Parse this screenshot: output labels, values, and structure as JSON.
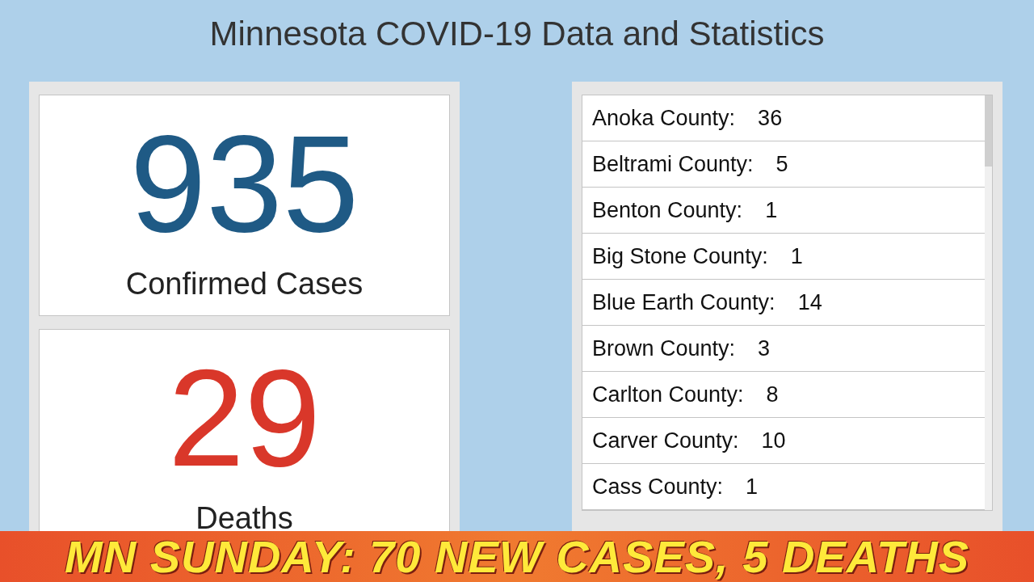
{
  "title": "Minnesota COVID-19 Data and Statistics",
  "stats": [
    {
      "value": "935",
      "label": "Confirmed Cases",
      "kind": "cases"
    },
    {
      "value": "29",
      "label": "Deaths",
      "kind": "deaths"
    }
  ],
  "counties": [
    {
      "name": "Anoka County:",
      "count": "36"
    },
    {
      "name": "Beltrami County:",
      "count": "5"
    },
    {
      "name": "Benton County:",
      "count": "1"
    },
    {
      "name": "Big Stone County:",
      "count": "1"
    },
    {
      "name": "Blue Earth County:",
      "count": "14"
    },
    {
      "name": "Brown County:",
      "count": "3"
    },
    {
      "name": "Carlton County:",
      "count": "8"
    },
    {
      "name": "Carver County:",
      "count": "10"
    },
    {
      "name": "Cass County:",
      "count": "1"
    }
  ],
  "banner": "MN SUNDAY: 70 NEW CASES, 5 DEATHS"
}
